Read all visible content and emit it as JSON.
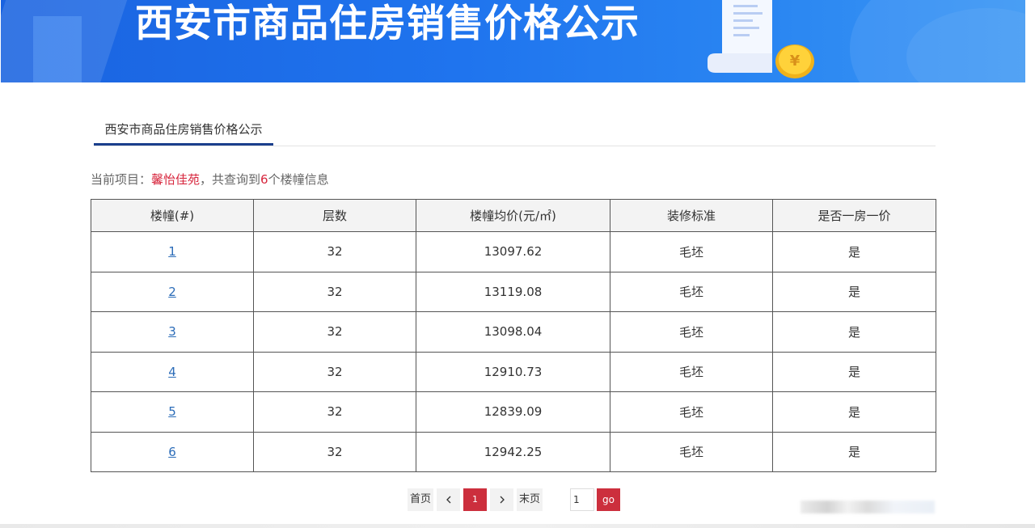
{
  "banner": {
    "title": "西安市商品住房销售价格公示"
  },
  "tabs": [
    {
      "label": "西安市商品住房销售价格公示"
    }
  ],
  "info": {
    "prefix": "当前项目：",
    "project": "馨怡佳苑",
    "middle": "，共查询到",
    "count": "6",
    "suffix": "个楼幢信息"
  },
  "table": {
    "headers": [
      "楼幢(#)",
      "层数",
      "楼幢均价(元/㎡)",
      "装修标准",
      "是否一房一价"
    ],
    "rows": [
      [
        "1",
        "32",
        "13097.62",
        "毛坯",
        "是"
      ],
      [
        "2",
        "32",
        "13119.08",
        "毛坯",
        "是"
      ],
      [
        "3",
        "32",
        "13098.04",
        "毛坯",
        "是"
      ],
      [
        "4",
        "32",
        "12910.73",
        "毛坯",
        "是"
      ],
      [
        "5",
        "32",
        "12839.09",
        "毛坯",
        "是"
      ],
      [
        "6",
        "32",
        "12942.25",
        "毛坯",
        "是"
      ]
    ]
  },
  "pagination": {
    "first": "首页",
    "current": "1",
    "last": "末页",
    "goto_value": "1",
    "go": "go"
  },
  "colors": {
    "banner": "#1f74ee",
    "accent_red": "#cc2f3d",
    "highlight_red": "#d7263d",
    "link_blue": "#2b6cb8",
    "tab_underline": "#1a3f8c"
  },
  "icons": {
    "banner_decoration": "receipt-coin-icon",
    "prev": "chevron-left-icon",
    "next": "chevron-right-icon"
  }
}
